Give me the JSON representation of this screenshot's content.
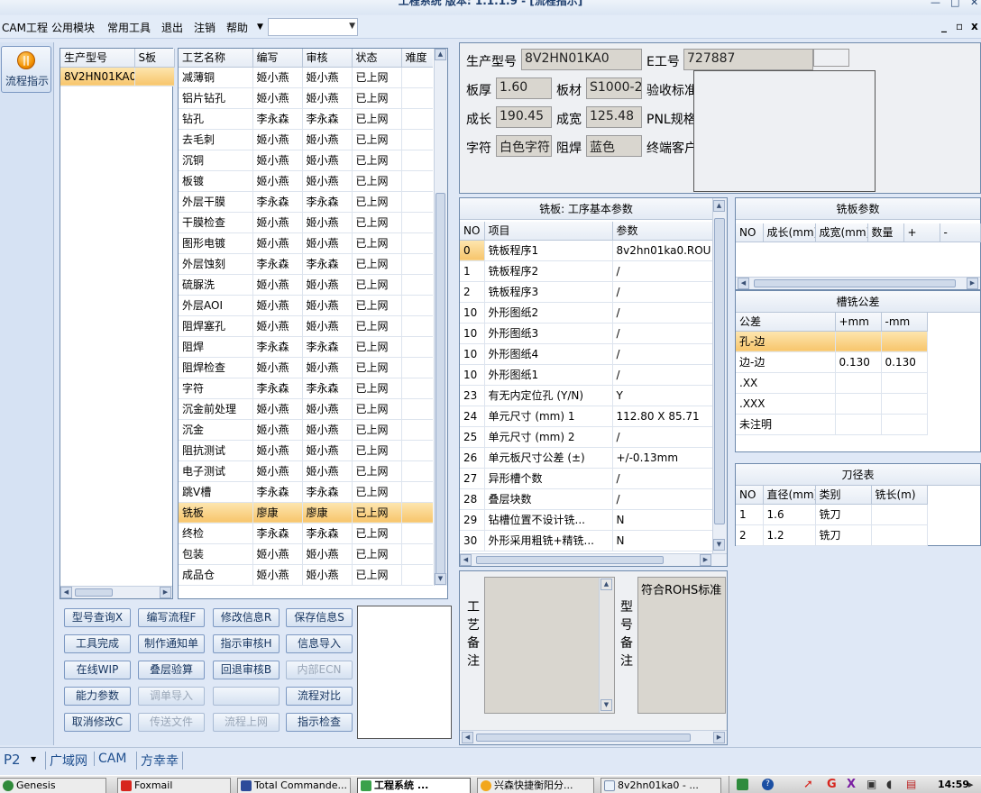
{
  "window": {
    "title": "工程系统 版本: 1.1.1.9 - [流程指示]"
  },
  "menu": {
    "items": [
      "CAM工程",
      "公用模块",
      "常用工具",
      "退出",
      "注销",
      "帮助"
    ],
    "combo_value": ""
  },
  "side": {
    "flow_label": "流程指示"
  },
  "model_list": {
    "headers": [
      "生产型号",
      "S板"
    ],
    "rows": [
      [
        "8V2HN01KA0",
        ""
      ]
    ]
  },
  "process_table": {
    "headers": [
      "工艺名称",
      "编写",
      "审核",
      "状态",
      "难度"
    ],
    "selected_index": 21,
    "rows": [
      [
        "减薄铜",
        "姬小燕",
        "姬小燕",
        "已上网",
        ""
      ],
      [
        "铝片钻孔",
        "姬小燕",
        "姬小燕",
        "已上网",
        ""
      ],
      [
        "钻孔",
        "李永森",
        "李永森",
        "已上网",
        ""
      ],
      [
        "去毛刺",
        "姬小燕",
        "姬小燕",
        "已上网",
        ""
      ],
      [
        "沉铜",
        "姬小燕",
        "姬小燕",
        "已上网",
        ""
      ],
      [
        "板镀",
        "姬小燕",
        "姬小燕",
        "已上网",
        ""
      ],
      [
        "外层干膜",
        "李永森",
        "李永森",
        "已上网",
        ""
      ],
      [
        "干膜检查",
        "姬小燕",
        "姬小燕",
        "已上网",
        ""
      ],
      [
        "图形电镀",
        "姬小燕",
        "姬小燕",
        "已上网",
        ""
      ],
      [
        "外层蚀刻",
        "李永森",
        "李永森",
        "已上网",
        ""
      ],
      [
        "硫脲洗",
        "姬小燕",
        "姬小燕",
        "已上网",
        ""
      ],
      [
        "外层AOI",
        "姬小燕",
        "姬小燕",
        "已上网",
        ""
      ],
      [
        "阻焊塞孔",
        "姬小燕",
        "姬小燕",
        "已上网",
        ""
      ],
      [
        "阻焊",
        "李永森",
        "李永森",
        "已上网",
        ""
      ],
      [
        "阻焊检查",
        "姬小燕",
        "姬小燕",
        "已上网",
        ""
      ],
      [
        "字符",
        "李永森",
        "李永森",
        "已上网",
        ""
      ],
      [
        "沉金前处理",
        "姬小燕",
        "姬小燕",
        "已上网",
        ""
      ],
      [
        "沉金",
        "姬小燕",
        "姬小燕",
        "已上网",
        ""
      ],
      [
        "阻抗测试",
        "姬小燕",
        "姬小燕",
        "已上网",
        ""
      ],
      [
        "电子测试",
        "姬小燕",
        "姬小燕",
        "已上网",
        ""
      ],
      [
        "跳V槽",
        "李永森",
        "李永森",
        "已上网",
        ""
      ],
      [
        "铣板",
        "廖康",
        "廖康",
        "已上网",
        ""
      ],
      [
        "终检",
        "李永森",
        "李永森",
        "已上网",
        ""
      ],
      [
        "包装",
        "姬小燕",
        "姬小燕",
        "已上网",
        ""
      ],
      [
        "成品仓",
        "姬小燕",
        "姬小燕",
        "已上网",
        ""
      ]
    ]
  },
  "info": {
    "model_label": "生产型号",
    "model_value": "8V2HN01KA0",
    "e_label": "E工号",
    "e_value": "727887",
    "thick_label": "板厚",
    "thick_value": "1.60",
    "material_label": "板材",
    "material_value": "S1000-2",
    "accept_label": "验收标准",
    "length_label": "成长",
    "length_value": "190.45",
    "width_label": "成宽",
    "width_value": "125.48",
    "pnl_label": "PNL规格",
    "char_label": "字符",
    "char_value": "白色字符",
    "mask_label": "阻焊",
    "mask_value": "蓝色",
    "customer_label": "终端客户"
  },
  "params": {
    "title": "铣板: 工序基本参数",
    "headers": [
      "NO",
      "项目",
      "参数"
    ],
    "selected_index": 0,
    "rows": [
      [
        "0",
        "铣板程序1",
        "8v2hn01ka0.ROU"
      ],
      [
        "1",
        "铣板程序2",
        "/"
      ],
      [
        "2",
        "铣板程序3",
        "/"
      ],
      [
        "10",
        "外形图纸2",
        "/"
      ],
      [
        "10",
        "外形图纸3",
        "/"
      ],
      [
        "10",
        "外形图纸4",
        "/"
      ],
      [
        "10",
        "外形图纸1",
        "/"
      ],
      [
        "23",
        "有无内定位孔 (Y/N)",
        "Y"
      ],
      [
        "24",
        "单元尺寸 (mm) 1",
        "112.80 X 85.71"
      ],
      [
        "25",
        "单元尺寸 (mm) 2",
        "/"
      ],
      [
        "26",
        "单元板尺寸公差 (±)",
        "+/-0.13mm"
      ],
      [
        "27",
        "异形槽个数",
        "/"
      ],
      [
        "28",
        "叠层块数",
        "/"
      ],
      [
        "29",
        "钻槽位置不设计铣...",
        "N"
      ],
      [
        "30",
        "外形采用粗铣+精铣...",
        "N"
      ]
    ]
  },
  "mill_params": {
    "title": "铣板参数",
    "headers": [
      "NO",
      "成长(mm)",
      "成宽(mm)",
      "数量",
      "+",
      "-"
    ]
  },
  "tolerance": {
    "title": "槽铣公差",
    "headers": [
      "公差",
      "+mm",
      "-mm"
    ],
    "selected_index": 0,
    "rows": [
      [
        "孔-边",
        "",
        ""
      ],
      [
        "边-边",
        "0.130",
        "0.130"
      ],
      [
        ".XX",
        "",
        ""
      ],
      [
        ".XXX",
        "",
        ""
      ],
      [
        "未注明",
        "",
        ""
      ]
    ]
  },
  "tools": {
    "title": "刀径表",
    "headers": [
      "NO",
      "直径(mm)",
      "类别",
      "铣长(m)"
    ],
    "rows": [
      [
        "1",
        "1.6",
        "铣刀",
        ""
      ],
      [
        "2",
        "1.2",
        "铣刀",
        ""
      ]
    ]
  },
  "notes": {
    "process_label": "工艺备注",
    "model_label": "型号备注",
    "model_text": "符合ROHS标准"
  },
  "buttons": [
    {
      "label": "型号查询X",
      "enabled": true
    },
    {
      "label": "编写流程F",
      "enabled": true
    },
    {
      "label": "修改信息R",
      "enabled": true
    },
    {
      "label": "保存信息S",
      "enabled": true
    },
    {
      "label": "工具完成",
      "enabled": true
    },
    {
      "label": "制作通知单",
      "enabled": true
    },
    {
      "label": "指示审核H",
      "enabled": true
    },
    {
      "label": "信息导入",
      "enabled": true
    },
    {
      "label": "在线WIP",
      "enabled": true
    },
    {
      "label": "叠层验算",
      "enabled": true
    },
    {
      "label": "回退审核B",
      "enabled": true
    },
    {
      "label": "内部ECN",
      "enabled": false
    },
    {
      "label": "能力参数",
      "enabled": true
    },
    {
      "label": "调单导入",
      "enabled": false
    },
    {
      "label": "",
      "enabled": false
    },
    {
      "label": "流程对比",
      "enabled": true
    },
    {
      "label": "取消修改C",
      "enabled": true
    },
    {
      "label": "传送文件",
      "enabled": false
    },
    {
      "label": "流程上网",
      "enabled": false
    },
    {
      "label": "指示检查",
      "enabled": true
    }
  ],
  "status": {
    "p_value": "P2",
    "tabs": [
      "广域网",
      "CAM",
      "方幸幸"
    ]
  },
  "taskbar": {
    "items": [
      "Genesis",
      "Foxmail",
      "Total Commande...",
      "工程系统 ...",
      "兴森快捷衡阳分...",
      "8v2hn01ka0 - ..."
    ],
    "active_index": 3,
    "time": "14:59"
  },
  "colors": {
    "selection": "#f7c56c",
    "accent": "#f39200",
    "frame": "#6f8aac"
  }
}
